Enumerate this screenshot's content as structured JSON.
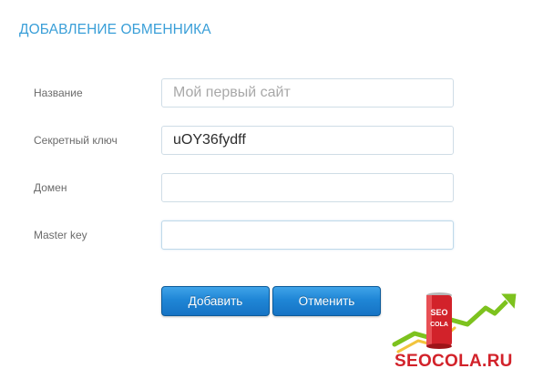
{
  "page": {
    "title": "ДОБАВЛЕНИЕ ОБМЕННИКА"
  },
  "form": {
    "fields": [
      {
        "label": "Название",
        "value": "",
        "placeholder": "Мой первый сайт"
      },
      {
        "label": "Секретный ключ",
        "value": "uOY36fydff",
        "placeholder": ""
      },
      {
        "label": "Домен",
        "value": "",
        "placeholder": ""
      },
      {
        "label": "Master key",
        "value": "",
        "placeholder": ""
      }
    ],
    "submit_label": "Добавить",
    "cancel_label": "Отменить"
  },
  "watermark": {
    "can_text_top": "SEO",
    "can_text_bottom": "COLA",
    "site": "SEOCOLA.RU"
  },
  "colors": {
    "title": "#3a9fd8",
    "button": "#1f86d6",
    "watermark": "#d2222a",
    "arrow": "#7dc21e"
  }
}
